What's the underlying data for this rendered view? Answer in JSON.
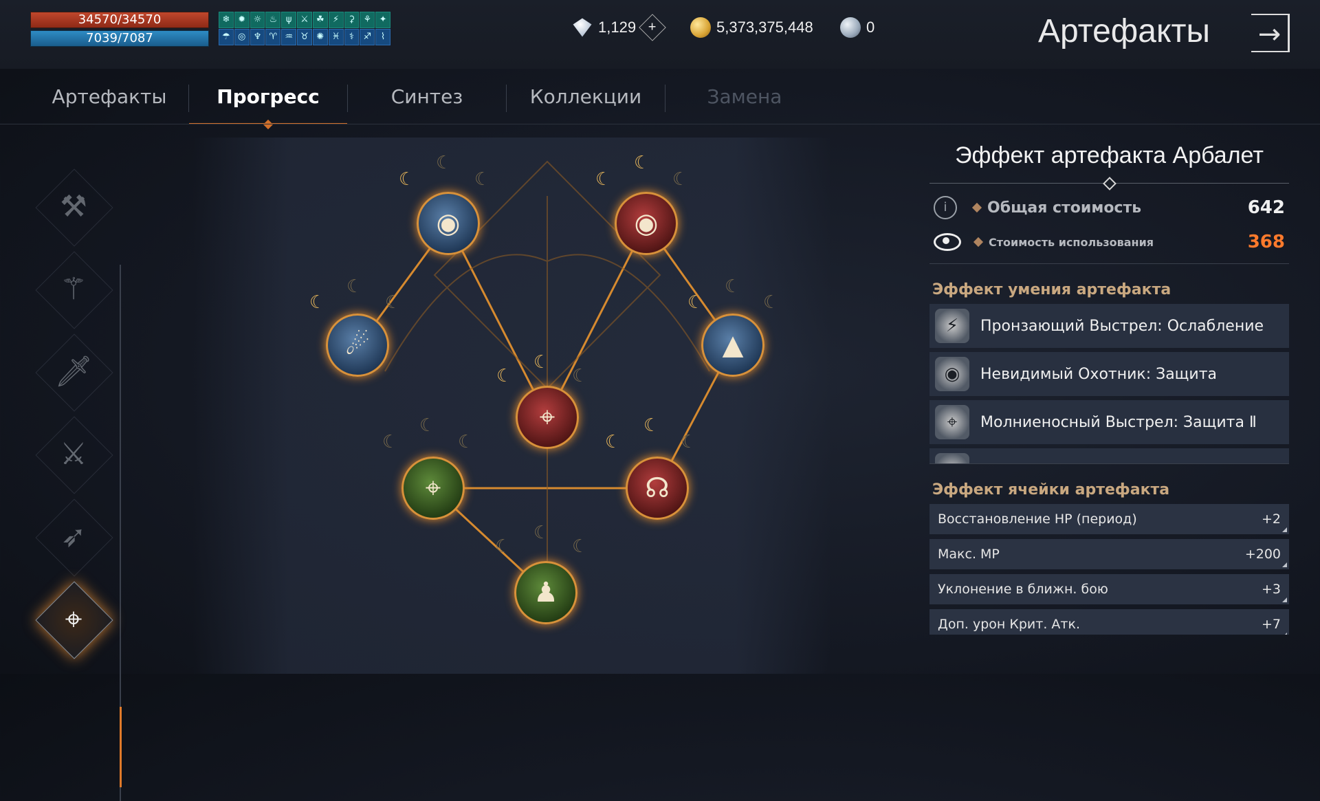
{
  "stats": {
    "hp": "34570/34570",
    "mp": "7039/7087"
  },
  "buffs": {
    "row1": [
      "❄",
      "✹",
      "☼",
      "♨",
      "ψ",
      "⚔",
      "☘",
      "⚡",
      "⚳",
      "⚘",
      "✦"
    ],
    "row2": [
      "☂",
      "◎",
      "♆",
      "♈",
      "♒",
      "♉",
      "✺",
      "♓",
      "⚕",
      "♐",
      "⌇"
    ]
  },
  "currency": {
    "diamonds": "1,129",
    "gold": "5,373,375,448",
    "silver": "0",
    "add_symbol": "+"
  },
  "header": {
    "title": "Артефакты",
    "exit_symbol": "→"
  },
  "tabs": [
    {
      "label": "Артефакты",
      "state": "normal"
    },
    {
      "label": "Прогресс",
      "state": "active"
    },
    {
      "label": "Синтез",
      "state": "normal"
    },
    {
      "label": "Коллекции",
      "state": "normal"
    },
    {
      "label": "Замена",
      "state": "disabled"
    }
  ],
  "weapons": [
    {
      "icon": "double-axe-icon",
      "glyph": "⚒"
    },
    {
      "icon": "halberd-icon",
      "glyph": "⚚"
    },
    {
      "icon": "dagger-icon",
      "glyph": "🗡"
    },
    {
      "icon": "sword-icon",
      "glyph": "⚔"
    },
    {
      "icon": "bow-icon",
      "glyph": "➶"
    },
    {
      "icon": "crossbow-icon",
      "glyph": "⌖",
      "active": true
    }
  ],
  "tree_nodes": [
    {
      "id": "n1",
      "color": "blue",
      "glyph": "◉"
    },
    {
      "id": "n2",
      "color": "red",
      "glyph": "◉"
    },
    {
      "id": "n3",
      "color": "blue",
      "glyph": "☄"
    },
    {
      "id": "n4",
      "color": "blue",
      "glyph": "▲"
    },
    {
      "id": "n5",
      "color": "red",
      "glyph": "⌖"
    },
    {
      "id": "n6",
      "color": "green",
      "glyph": "⌖"
    },
    {
      "id": "n7",
      "color": "red",
      "glyph": "☊"
    },
    {
      "id": "n8",
      "color": "green",
      "glyph": "♟"
    }
  ],
  "moon_glyph": "☾",
  "panel": {
    "title": "Эффект артефакта Арбалет",
    "total_cost_label": "Общая стоимость",
    "total_cost_value": "642",
    "use_cost_label": "Стоимость использования",
    "use_cost_value": "368",
    "info_symbol": "i",
    "skill_section_title": "Эффект умения артефакта",
    "skills": [
      {
        "name": "Пронзающий Выстрел: Ослабление",
        "icon_glyph": "⚡"
      },
      {
        "name": "Невидимый Охотник: Защита",
        "icon_glyph": "◉"
      },
      {
        "name": "Молниеносный Выстрел: Защита Ⅱ",
        "icon_glyph": "⌖"
      },
      {
        "name": "",
        "icon_glyph": "◐"
      }
    ],
    "cell_section_title": "Эффект ячейки артефакта",
    "cells": [
      {
        "label": "Восстановление HP (период)",
        "value": "+2"
      },
      {
        "label": "Макс. MP",
        "value": "+200"
      },
      {
        "label": "Уклонение в ближн. бою",
        "value": "+3"
      },
      {
        "label": "Доп. урон Крит. Атк.",
        "value": "+7"
      }
    ]
  }
}
